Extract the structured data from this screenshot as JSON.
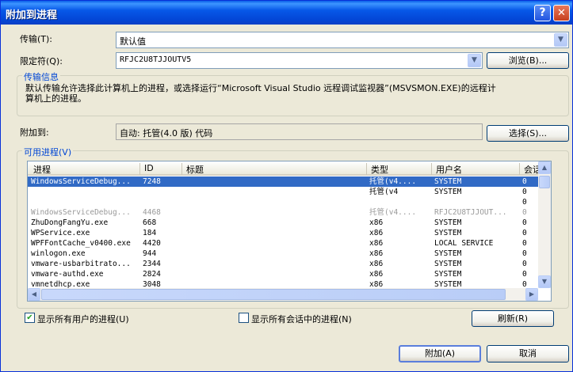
{
  "window": {
    "title": "附加到进程",
    "help": "?",
    "close": "✕"
  },
  "transport": {
    "label": "传输(T):",
    "value": "默认值"
  },
  "qualifier": {
    "label": "限定符(Q):",
    "value": "RFJC2U8TJJOUTV5",
    "browse": "浏览(B)..."
  },
  "transport_info": {
    "title": "传输信息",
    "text_line1": "默认传输允许选择此计算机上的进程，或选择运行“Microsoft Visual Studio 远程调试监视器”(MSVSMON.EXE)的远程计",
    "text_line2": "算机上的进程。"
  },
  "attach_to": {
    "label": "附加到:",
    "value": "自动: 托管(4.0 版) 代码",
    "select": "选择(S)..."
  },
  "available": {
    "title": "可用进程(V)",
    "columns": [
      "进程",
      "ID",
      "标题",
      "类型",
      "用户名",
      "会话"
    ],
    "rows": [
      {
        "process": "WindowsServiceDebug...",
        "id": "7248",
        "title": "",
        "type": "托管(v4....",
        "user": "SYSTEM",
        "session": "0",
        "state": "sel"
      },
      {
        "process": "",
        "id": "",
        "title": "",
        "type": "托管(v4",
        "user": "SYSTEM",
        "session": "0",
        "state": "normal"
      },
      {
        "process": "",
        "id": "",
        "title": "",
        "type": "",
        "user": "",
        "session": "0",
        "state": "normal"
      },
      {
        "process": "WindowsServiceDebug...",
        "id": "4468",
        "title": "",
        "type": "托管(v4....",
        "user": "RFJC2U8TJJOUT...",
        "session": "0",
        "state": "gray"
      },
      {
        "process": "ZhuDongFangYu.exe",
        "id": "668",
        "title": "",
        "type": "x86",
        "user": "SYSTEM",
        "session": "0",
        "state": "normal"
      },
      {
        "process": "WPService.exe",
        "id": "184",
        "title": "",
        "type": "x86",
        "user": "SYSTEM",
        "session": "0",
        "state": "normal"
      },
      {
        "process": "WPFFontCache_v0400.exe",
        "id": "4420",
        "title": "",
        "type": "x86",
        "user": "LOCAL SERVICE",
        "session": "0",
        "state": "normal"
      },
      {
        "process": "winlogon.exe",
        "id": "944",
        "title": "",
        "type": "x86",
        "user": "SYSTEM",
        "session": "0",
        "state": "normal"
      },
      {
        "process": "vmware-usbarbitrato...",
        "id": "2344",
        "title": "",
        "type": "x86",
        "user": "SYSTEM",
        "session": "0",
        "state": "normal"
      },
      {
        "process": "vmware-authd.exe",
        "id": "2824",
        "title": "",
        "type": "x86",
        "user": "SYSTEM",
        "session": "0",
        "state": "normal"
      },
      {
        "process": "vmnetdhcp.exe",
        "id": "3048",
        "title": "",
        "type": "x86",
        "user": "SYSTEM",
        "session": "0",
        "state": "normal"
      }
    ],
    "scroll_up": "▲",
    "scroll_down": "▼",
    "scroll_left": "◀",
    "scroll_right": "▶"
  },
  "options": {
    "all_users": {
      "label": "显示所有用户的进程(U)",
      "checked": true,
      "mark": "✔"
    },
    "all_sessions": {
      "label": "显示所有会话中的进程(N)",
      "checked": false
    },
    "refresh": "刷新(R)"
  },
  "footer": {
    "attach": "附加(A)",
    "cancel": "取消"
  }
}
